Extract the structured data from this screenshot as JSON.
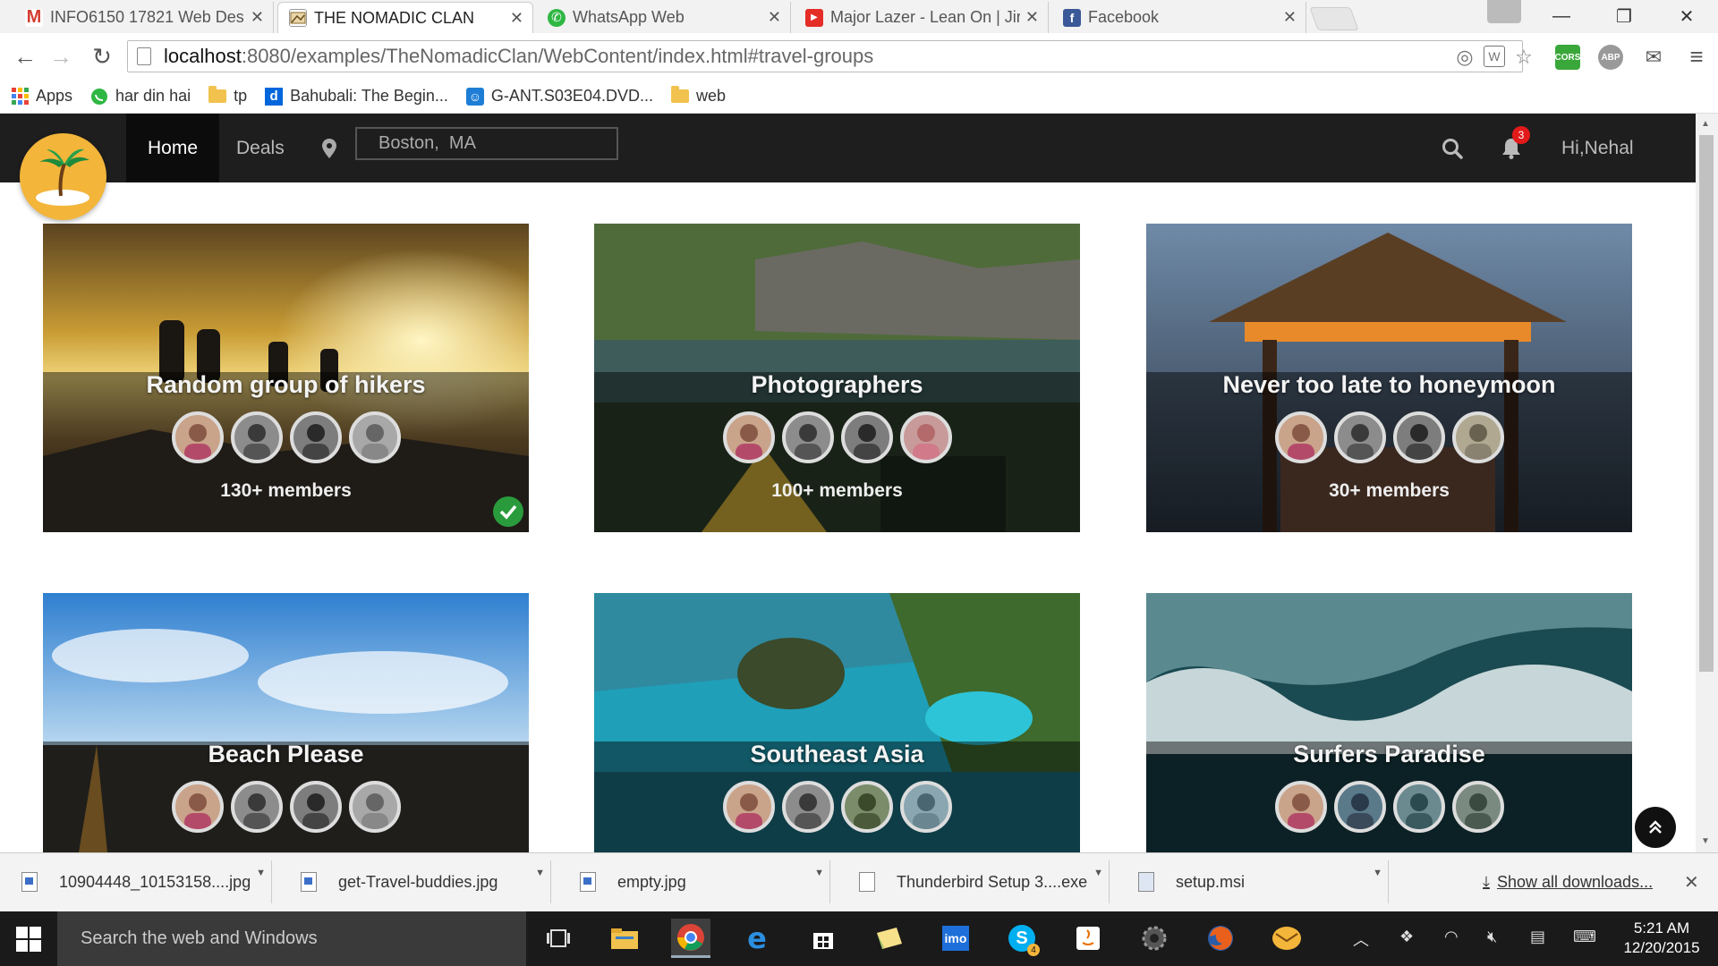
{
  "browser": {
    "tabs": [
      {
        "title": "INFO6150 17821 Web Des",
        "favicon": "gmail-icon",
        "active": false
      },
      {
        "title": "THE NOMADIC CLAN",
        "favicon": "nomadic-clan-icon",
        "active": true
      },
      {
        "title": "WhatsApp Web",
        "favicon": "whatsapp-icon",
        "active": false
      },
      {
        "title": "Major Lazer - Lean On | Jir",
        "favicon": "youtube-icon",
        "active": false
      },
      {
        "title": "Facebook",
        "favicon": "facebook-icon",
        "active": false
      }
    ],
    "url_host": "localhost",
    "url_path": ":8080/examples/TheNomadicClan/WebContent/index.html#travel-groups",
    "extensions": [
      "CORS",
      "ABP"
    ],
    "bookmarks": [
      {
        "label": "Apps",
        "icon": "apps-grid-icon"
      },
      {
        "label": "har din hai",
        "icon": "whatsapp-icon"
      },
      {
        "label": "tp",
        "icon": "folder-icon"
      },
      {
        "label": "Bahubali: The Begin...",
        "icon": "dailymotion-icon"
      },
      {
        "label": "G-ANT.S03E04.DVD...",
        "icon": "smiley-icon"
      },
      {
        "label": "web",
        "icon": "folder-icon"
      }
    ]
  },
  "site": {
    "nav": {
      "home": "Home",
      "deals": "Deals",
      "location": "Boston,  MA",
      "notification_count": "3",
      "greeting": "Hi,Nehal"
    },
    "groups": [
      {
        "title": "Random group of hikers",
        "members": "130+ members",
        "joined": true,
        "theme": "sunset"
      },
      {
        "title": "Photographers",
        "members": "100+ members",
        "joined": false,
        "theme": "forest"
      },
      {
        "title": "Never too late to honeymoon",
        "members": "30+ members",
        "joined": false,
        "theme": "hut"
      },
      {
        "title": "Beach Please",
        "members": "",
        "joined": false,
        "theme": "sky"
      },
      {
        "title": "Southeast Asia",
        "members": "",
        "joined": false,
        "theme": "lagoon"
      },
      {
        "title": "Surfers Paradise",
        "members": "",
        "joined": false,
        "theme": "wave"
      }
    ]
  },
  "downloads": {
    "items": [
      "10904448_10153158....jpg",
      "get-Travel-buddies.jpg",
      "empty.jpg",
      "Thunderbird Setup 3....exe",
      "setup.msi"
    ],
    "show_all": "Show all downloads..."
  },
  "taskbar": {
    "search_placeholder": "Search the web and Windows",
    "time": "5:21 AM",
    "date": "12/20/2015",
    "skype_badge": "4"
  },
  "colors": {
    "site_nav_bg": "#1e1e1e",
    "logo_bg": "#f3b53a",
    "badge_red": "#e21a1a",
    "joined_green": "#2a9b3c"
  }
}
